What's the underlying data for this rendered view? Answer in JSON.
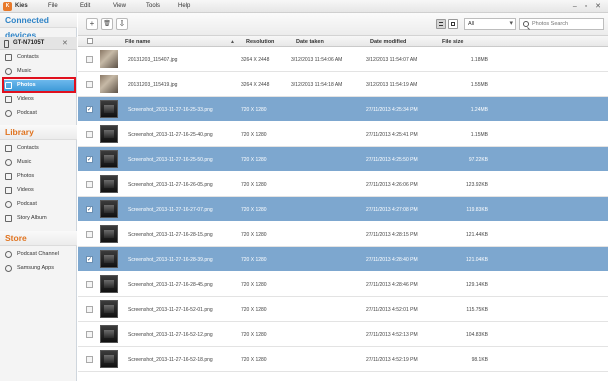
{
  "app": {
    "title": "Kies",
    "logo_text": "K"
  },
  "menu": [
    "File",
    "Edit",
    "View",
    "Tools",
    "Help"
  ],
  "window_controls": "– ▫ ✕",
  "sidebar": {
    "connected_devices_title": "Connected devices",
    "device": {
      "name": "GT-N7105T",
      "close": "✕"
    },
    "device_items": [
      {
        "label": "Contacts",
        "icon": "contacts-icon"
      },
      {
        "label": "Music",
        "icon": "music-icon"
      },
      {
        "label": "Photos",
        "icon": "photos-icon",
        "selected": true
      },
      {
        "label": "Videos",
        "icon": "videos-icon"
      },
      {
        "label": "Podcast",
        "icon": "podcast-icon"
      }
    ],
    "library_title": "Library",
    "library_items": [
      {
        "label": "Contacts",
        "icon": "contacts-icon"
      },
      {
        "label": "Music",
        "icon": "music-icon"
      },
      {
        "label": "Photos",
        "icon": "photos-icon"
      },
      {
        "label": "Videos",
        "icon": "videos-icon"
      },
      {
        "label": "Podcast",
        "icon": "podcast-icon"
      },
      {
        "label": "Story Album",
        "icon": "story-album-icon"
      }
    ],
    "store_title": "Store",
    "store_items": [
      {
        "label": "Podcast Channel",
        "icon": "podcast-channel-icon"
      },
      {
        "label": "Samsung Apps",
        "icon": "samsung-apps-icon"
      }
    ]
  },
  "toolbar": {
    "add": "+",
    "delete": "🗑",
    "export": "⇩",
    "filter_value": "All",
    "filter_arrow": "▾",
    "search_placeholder": "Photos Search"
  },
  "table": {
    "columns": {
      "file_name": "File name",
      "resolution": "Resolution",
      "date_taken": "Date taken",
      "date_modified": "Date modified",
      "file_size": "File size"
    },
    "sort_arrow": "▲",
    "rows": [
      {
        "file_name": "20131203_115407.jpg",
        "resolution": "3264 X 2448",
        "date_taken": "3/12/2013 11:54:06 AM",
        "date_modified": "3/12/2013 11:54:07 AM",
        "file_size": "1.18MB",
        "selected": false,
        "thumb": "photo"
      },
      {
        "file_name": "20131203_115419.jpg",
        "resolution": "3264 X 2448",
        "date_taken": "3/12/2013 11:54:18 AM",
        "date_modified": "3/12/2013 11:54:19 AM",
        "file_size": "1.55MB",
        "selected": false,
        "thumb": "photo"
      },
      {
        "file_name": "Screenshot_2013-11-27-16-25-33.png",
        "resolution": "720 X 1280",
        "date_taken": "",
        "date_modified": "27/11/2013 4:25:34 PM",
        "file_size": "1.24MB",
        "selected": true,
        "thumb": "shot"
      },
      {
        "file_name": "Screenshot_2013-11-27-16-25-40.png",
        "resolution": "720 X 1280",
        "date_taken": "",
        "date_modified": "27/11/2013 4:25:41 PM",
        "file_size": "1.15MB",
        "selected": false,
        "thumb": "shot"
      },
      {
        "file_name": "Screenshot_2013-11-27-16-25-50.png",
        "resolution": "720 X 1280",
        "date_taken": "",
        "date_modified": "27/11/2013 4:25:50 PM",
        "file_size": "97.22KB",
        "selected": true,
        "thumb": "shot"
      },
      {
        "file_name": "Screenshot_2013-11-27-16-26-05.png",
        "resolution": "720 X 1280",
        "date_taken": "",
        "date_modified": "27/11/2013 4:26:06 PM",
        "file_size": "123.92KB",
        "selected": false,
        "thumb": "shot"
      },
      {
        "file_name": "Screenshot_2013-11-27-16-27-07.png",
        "resolution": "720 X 1280",
        "date_taken": "",
        "date_modified": "27/11/2013 4:27:08 PM",
        "file_size": "119.83KB",
        "selected": true,
        "thumb": "shot"
      },
      {
        "file_name": "Screenshot_2013-11-27-16-28-15.png",
        "resolution": "720 X 1280",
        "date_taken": "",
        "date_modified": "27/11/2013 4:28:15 PM",
        "file_size": "121.44KB",
        "selected": false,
        "thumb": "shot"
      },
      {
        "file_name": "Screenshot_2013-11-27-16-28-39.png",
        "resolution": "720 X 1280",
        "date_taken": "",
        "date_modified": "27/11/2013 4:28:40 PM",
        "file_size": "121.04KB",
        "selected": true,
        "thumb": "shot"
      },
      {
        "file_name": "Screenshot_2013-11-27-16-28-45.png",
        "resolution": "720 X 1280",
        "date_taken": "",
        "date_modified": "27/11/2013 4:28:46 PM",
        "file_size": "129.14KB",
        "selected": false,
        "thumb": "shot"
      },
      {
        "file_name": "Screenshot_2013-11-27-16-52-01.png",
        "resolution": "720 X 1280",
        "date_taken": "",
        "date_modified": "27/11/2013 4:52:01 PM",
        "file_size": "115.75KB",
        "selected": false,
        "thumb": "shot"
      },
      {
        "file_name": "Screenshot_2013-11-27-16-52-12.png",
        "resolution": "720 X 1280",
        "date_taken": "",
        "date_modified": "27/11/2013 4:52:13 PM",
        "file_size": "104.83KB",
        "selected": false,
        "thumb": "shot"
      },
      {
        "file_name": "Screenshot_2013-11-27-16-52-18.png",
        "resolution": "720 X 1280",
        "date_taken": "",
        "date_modified": "27/11/2013 4:52:19 PM",
        "file_size": "98.1KB",
        "selected": false,
        "thumb": "shot"
      }
    ]
  },
  "colors": {
    "accent_blue": "#2f84c7",
    "library_orange": "#e0731f",
    "selected_row": "#7da7cf",
    "highlight_red": "#e0101e"
  }
}
